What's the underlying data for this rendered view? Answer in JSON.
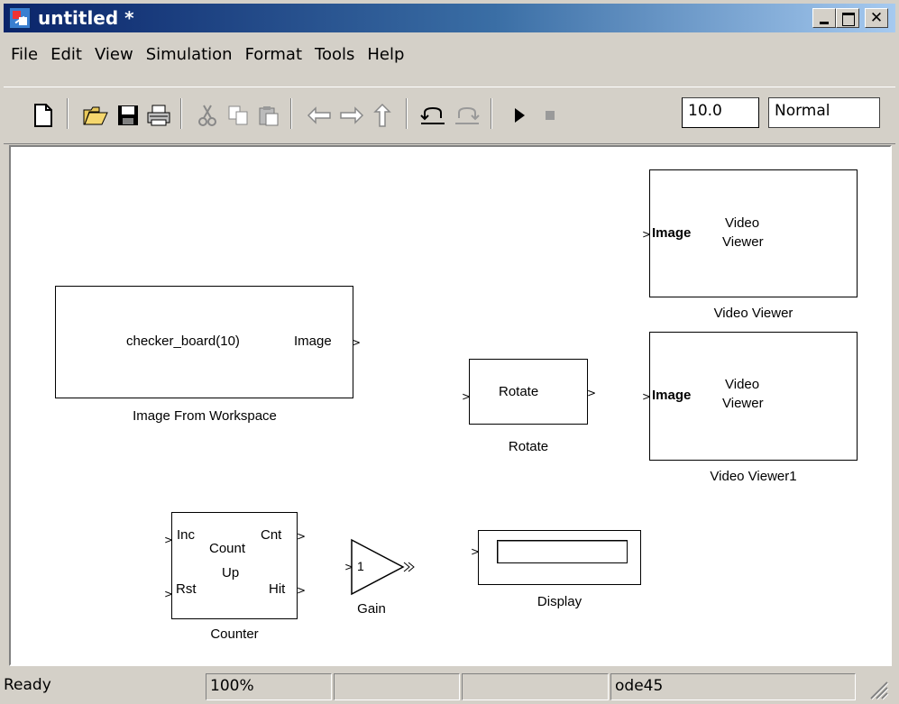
{
  "window": {
    "title": "untitled *"
  },
  "menu": [
    "File",
    "Edit",
    "View",
    "Simulation",
    "Format",
    "Tools",
    "Help"
  ],
  "toolbar": {
    "icons": [
      "new-icon",
      "open-icon",
      "save-icon",
      "print-icon",
      "cut-icon",
      "copy-icon",
      "paste-icon",
      "back-icon",
      "forward-icon",
      "up-icon",
      "undo-icon",
      "redo-icon",
      "start-simulation-icon",
      "stop-simulation-icon"
    ],
    "stop_time": "10.0",
    "sim_mode": "Normal"
  },
  "blocks": {
    "image_from_workspace": {
      "content": "checker_board(10)",
      "out_port": "Image",
      "name": "Image From Workspace"
    },
    "video_viewer": {
      "in_port": "Image",
      "line1": "Video",
      "line2": "Viewer",
      "name": "Video Viewer"
    },
    "video_viewer1": {
      "in_port": "Image",
      "line1": "Video",
      "line2": "Viewer",
      "name": "Video Viewer1"
    },
    "rotate": {
      "content": "Rotate",
      "name": "Rotate"
    },
    "counter": {
      "inc": "Inc",
      "cnt": "Cnt",
      "line1": "Count",
      "line2": "Up",
      "rst": "Rst",
      "hit": "Hit",
      "name": "Counter"
    },
    "gain": {
      "value": "1",
      "name": "Gain"
    },
    "display": {
      "name": "Display"
    }
  },
  "status": {
    "state": "Ready",
    "zoom": "100%",
    "solver": "ode45"
  }
}
